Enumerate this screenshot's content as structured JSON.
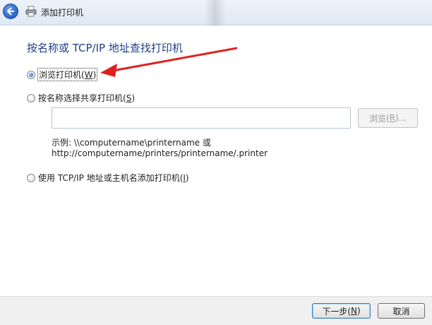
{
  "window": {
    "title": "添加打印机",
    "back_icon": "back-arrow-icon",
    "printer_icon": "printer-icon"
  },
  "heading": "按名称或 TCP/IP 地址查找打印机",
  "options": [
    {
      "label_main": "浏览打印机(",
      "mnemonic": "W",
      "label_end": ")",
      "checked": true
    },
    {
      "label_main": "按名称选择共享打印机(",
      "mnemonic": "S",
      "label_end": ")",
      "checked": false
    },
    {
      "label_main": "使用 TCP/IP 地址或主机名添加打印机(",
      "mnemonic": "I",
      "label_end": ")",
      "checked": false
    }
  ],
  "share_input": {
    "value": "",
    "placeholder": ""
  },
  "browse_button": {
    "label_main": "浏览(",
    "mnemonic": "R",
    "label_end": ")...",
    "enabled": false
  },
  "example": {
    "line1": "示例: \\\\computername\\printername 或",
    "line2": "http://computername/printers/printername/.printer"
  },
  "footer": {
    "next": {
      "label_main": "下一步(",
      "mnemonic": "N",
      "label_end": ")"
    },
    "cancel": "取消"
  },
  "annotation": {
    "type": "red-arrow",
    "color": "#e02020"
  }
}
